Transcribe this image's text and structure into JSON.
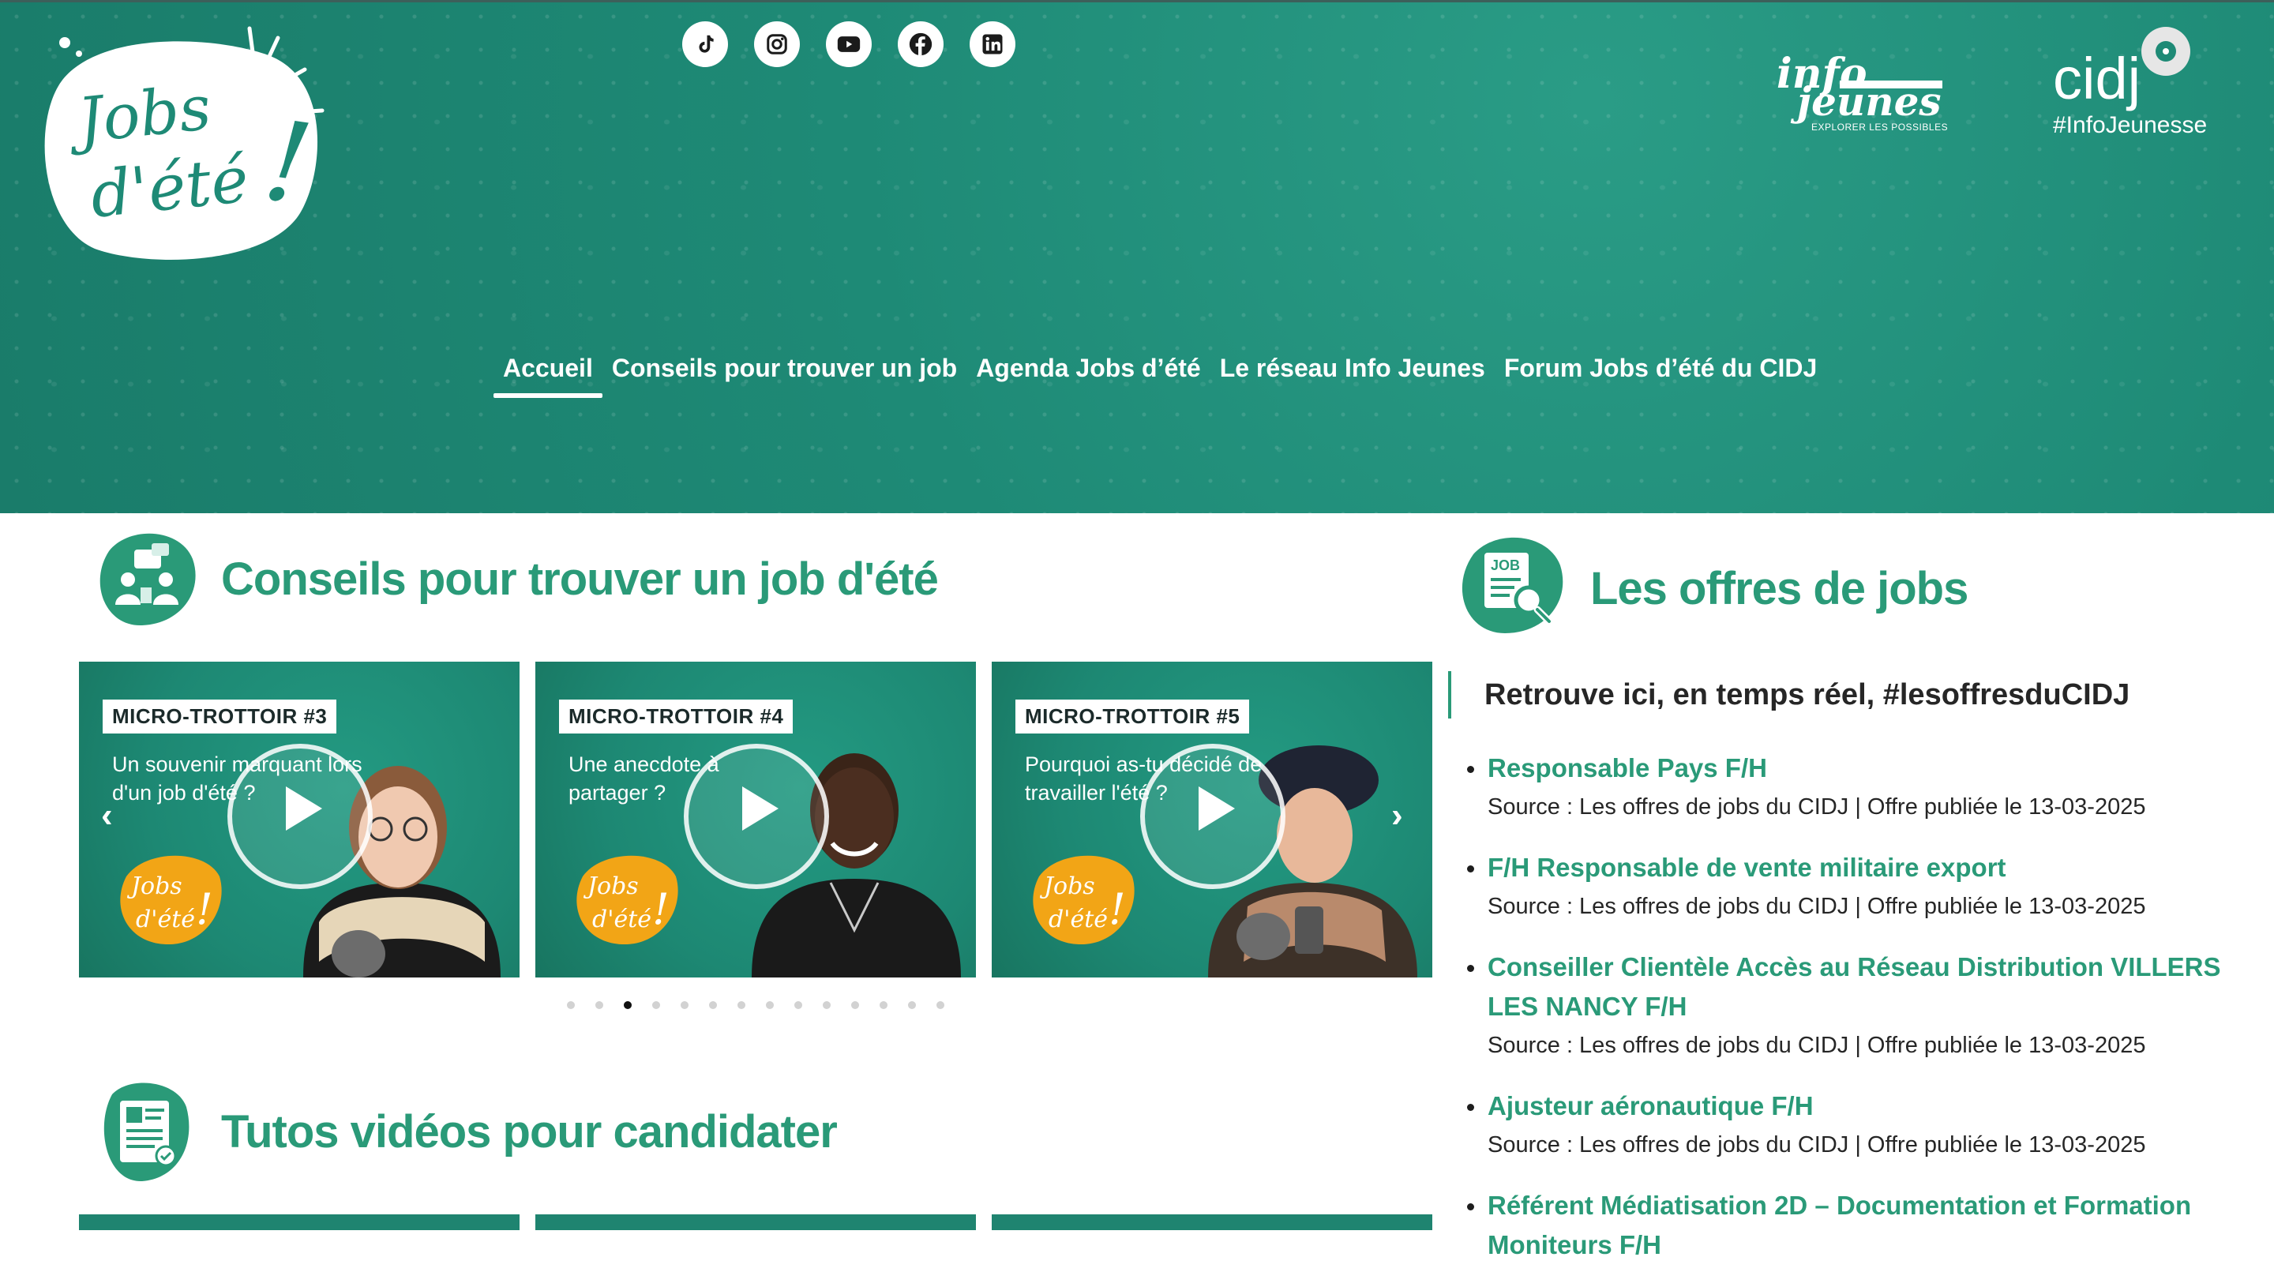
{
  "header": {
    "social_icons": [
      "tiktok-icon",
      "instagram-icon",
      "youtube-icon",
      "facebook-icon",
      "linkedin-icon"
    ],
    "logo_line1": "Jobs",
    "logo_line2": "d'été",
    "logo_exclaim": "!",
    "partner1_line1": "info",
    "partner1_line2": "jeunes",
    "partner1_tagline": "EXPLORER LES POSSIBLES",
    "partner2_name": "cidj",
    "partner2_tag": "#InfoJeunesse",
    "nav": [
      {
        "label": "Accueil",
        "active": true
      },
      {
        "label": "Conseils pour trouver un job"
      },
      {
        "label": "Agenda Jobs d’été"
      },
      {
        "label": "Le réseau Info Jeunes"
      },
      {
        "label": "Forum Jobs d’été du CIDJ"
      }
    ]
  },
  "conseils": {
    "title": "Conseils pour trouver un job d'été",
    "cards": [
      {
        "tag": "MICRO-TROTTOIR #3",
        "text": "Un souvenir marquant lors d'un job d'été ?"
      },
      {
        "tag": "MICRO-TROTTOIR #4",
        "text": "Une anecdote à partager ?"
      },
      {
        "tag": "MICRO-TROTTOIR #5",
        "text": "Pourquoi as-tu décidé de travailler l'été ?"
      }
    ],
    "card_logo_line1": "Jobs",
    "card_logo_line2": "d'été",
    "card_logo_exclaim": "!",
    "prev": "‹",
    "next": "›",
    "dot_count": 14,
    "active_dot": 3
  },
  "tutos": {
    "title": "Tutos vidéos pour candidater"
  },
  "offres": {
    "title": "Les offres de jobs",
    "icon_label": "JOB",
    "intro": "Retrouve ici, en temps réel, #lesoffresduCIDJ",
    "jobs": [
      {
        "title": "Responsable Pays F/H",
        "meta": "Source : Les offres de jobs du CIDJ | Offre publiée le 13-03-2025"
      },
      {
        "title": "F/H Responsable de vente militaire export",
        "meta": "Source : Les offres de jobs du CIDJ | Offre publiée le 13-03-2025"
      },
      {
        "title": "Conseiller Clientèle Accès au Réseau Distribution VILLERS LES NANCY F/H",
        "meta": "Source : Les offres de jobs du CIDJ | Offre publiée le 13-03-2025"
      },
      {
        "title": "Ajusteur aéronautique F/H",
        "meta": "Source : Les offres de jobs du CIDJ | Offre publiée le 13-03-2025"
      },
      {
        "title": "Référent Médiatisation 2D – Documentation et Formation Moniteurs F/H",
        "meta": ""
      }
    ]
  },
  "colors": {
    "brand_green": "#2a9a78",
    "header_green": "#1e8a76",
    "accent_orange": "#f2a516"
  }
}
